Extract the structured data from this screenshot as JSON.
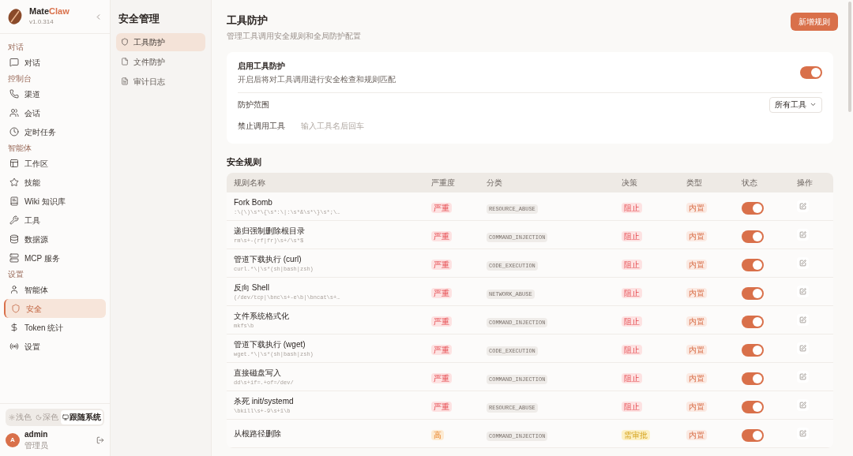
{
  "brand": {
    "name_a": "Mate",
    "name_b": "Claw",
    "version": "v1.0.314"
  },
  "nav": [
    {
      "heading": "对话",
      "items": [
        {
          "label": "对话",
          "selected": false
        }
      ]
    },
    {
      "heading": "控制台",
      "items": [
        {
          "label": "渠道",
          "selected": false
        },
        {
          "label": "会话",
          "selected": false
        },
        {
          "label": "定时任务",
          "selected": false
        }
      ]
    },
    {
      "heading": "智能体",
      "items": [
        {
          "label": "工作区",
          "selected": false
        },
        {
          "label": "技能",
          "selected": false
        },
        {
          "label": "Wiki 知识库",
          "selected": false
        },
        {
          "label": "工具",
          "selected": false
        },
        {
          "label": "数据源",
          "selected": false
        },
        {
          "label": "MCP 服务",
          "selected": false
        }
      ]
    },
    {
      "heading": "设置",
      "items": [
        {
          "label": "智能体",
          "selected": false
        },
        {
          "label": "安全",
          "selected": true
        },
        {
          "label": "Token 统计",
          "selected": false
        },
        {
          "label": "设置",
          "selected": false
        }
      ]
    }
  ],
  "theme_options": [
    {
      "label": "浅色",
      "selected": false
    },
    {
      "label": "深色",
      "selected": false
    },
    {
      "label": "跟随系统",
      "selected": true
    }
  ],
  "user": {
    "initial": "A",
    "name": "admin",
    "role": "管理员"
  },
  "subnav": {
    "title": "安全管理",
    "items": [
      {
        "label": "工具防护",
        "selected": true
      },
      {
        "label": "文件防护",
        "selected": false
      },
      {
        "label": "审计日志",
        "selected": false
      }
    ]
  },
  "page": {
    "title": "工具防护",
    "subtitle": "管理工具调用安全规则和全局防护配置",
    "new_button": "新增规则"
  },
  "settings": {
    "enable_title": "启用工具防护",
    "enable_desc": "开启后将对工具调用进行安全检查和规则匹配",
    "enabled": true,
    "scope_label": "防护范围",
    "scope_value": "所有工具",
    "ban_label": "禁止调用工具",
    "ban_placeholder": "输入工具名后回车"
  },
  "rules_title": "安全规则",
  "columns": [
    "规则名称",
    "严重度",
    "分类",
    "决策",
    "类型",
    "状态",
    "操作"
  ],
  "rules": [
    {
      "name": "Fork Bomb",
      "pattern": ":\\(\\)\\s*\\{\\s*:\\|:\\s*&\\s*\\}\\s*;\\…",
      "severity": {
        "kind": "critical",
        "label": "严重"
      },
      "category": "RESOURCE_ABUSE",
      "decision": {
        "kind": "block",
        "label": "阻止"
      },
      "type": "内置",
      "enabled": true
    },
    {
      "name": "递归强制删除根目录",
      "pattern": "rm\\s+-(rf|fr)\\s+/\\s*$",
      "severity": {
        "kind": "critical",
        "label": "严重"
      },
      "category": "COMMAND_INJECTION",
      "decision": {
        "kind": "block",
        "label": "阻止"
      },
      "type": "内置",
      "enabled": true
    },
    {
      "name": "管道下载执行 (curl)",
      "pattern": "curl.*\\|\\s*(sh|bash|zsh)",
      "severity": {
        "kind": "critical",
        "label": "严重"
      },
      "category": "CODE_EXECUTION",
      "decision": {
        "kind": "block",
        "label": "阻止"
      },
      "type": "内置",
      "enabled": true
    },
    {
      "name": "反向 Shell",
      "pattern": "(/dev/tcp|\\bnc\\s+-e\\b|\\bncat\\s+…",
      "severity": {
        "kind": "critical",
        "label": "严重"
      },
      "category": "NETWORK_ABUSE",
      "decision": {
        "kind": "block",
        "label": "阻止"
      },
      "type": "内置",
      "enabled": true
    },
    {
      "name": "文件系统格式化",
      "pattern": "mkfs\\b",
      "severity": {
        "kind": "critical",
        "label": "严重"
      },
      "category": "COMMAND_INJECTION",
      "decision": {
        "kind": "block",
        "label": "阻止"
      },
      "type": "内置",
      "enabled": true
    },
    {
      "name": "管道下载执行 (wget)",
      "pattern": "wget.*\\|\\s*(sh|bash|zsh)",
      "severity": {
        "kind": "critical",
        "label": "严重"
      },
      "category": "CODE_EXECUTION",
      "decision": {
        "kind": "block",
        "label": "阻止"
      },
      "type": "内置",
      "enabled": true
    },
    {
      "name": "直接磁盘写入",
      "pattern": "dd\\s+if=.+of=/dev/",
      "severity": {
        "kind": "critical",
        "label": "严重"
      },
      "category": "COMMAND_INJECTION",
      "decision": {
        "kind": "block",
        "label": "阻止"
      },
      "type": "内置",
      "enabled": true
    },
    {
      "name": "杀死 init/systemd",
      "pattern": "\\bkill\\s+-9\\s+1\\b",
      "severity": {
        "kind": "critical",
        "label": "严重"
      },
      "category": "RESOURCE_ABUSE",
      "decision": {
        "kind": "block",
        "label": "阻止"
      },
      "type": "内置",
      "enabled": true
    },
    {
      "name": "从根路径删除",
      "severity": {
        "kind": "high",
        "label": "高"
      },
      "category": "COMMAND_INJECTION",
      "decision": {
        "kind": "approve",
        "label": "需审批"
      },
      "type": "内置",
      "enabled": true
    }
  ]
}
